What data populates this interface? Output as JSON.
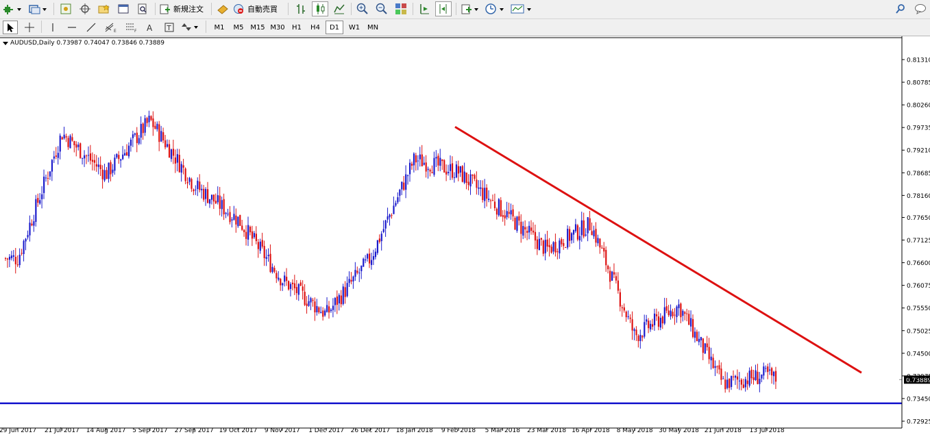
{
  "toolbar": {
    "new_order_label": "新規注文",
    "auto_trading_label": "自動売買"
  },
  "timeframes": [
    "M1",
    "M5",
    "M15",
    "M30",
    "H1",
    "H4",
    "D1",
    "W1",
    "MN"
  ],
  "active_timeframe": "D1",
  "chart": {
    "symbol": "AUDUSD,Daily",
    "ohlc": "0.73987 0.74047 0.73846 0.73889",
    "current_price": "0.73889"
  },
  "colors": {
    "bull": "#1a1acc",
    "bear": "#dd1111",
    "trendline": "#dd1111",
    "support": "#1010cc"
  },
  "chart_data": {
    "type": "candlestick",
    "symbol": "AUDUSD",
    "timeframe": "Daily",
    "y_ticks": [
      "0.81310",
      "0.80785",
      "0.80260",
      "0.79735",
      "0.79210",
      "0.78685",
      "0.78160",
      "0.77650",
      "0.77125",
      "0.76600",
      "0.76075",
      "0.75550",
      "0.75025",
      "0.74500",
      "0.73975",
      "0.73450",
      "0.72925"
    ],
    "x_ticks": [
      "29 Jun 2017",
      "21 Jul 2017",
      "14 Aug 2017",
      "5 Sep 2017",
      "27 Sep 2017",
      "19 Oct 2017",
      "9 Nov 2017",
      "1 Dec 2017",
      "26 Dec 2017",
      "18 Jan 2018",
      "9 Feb 2018",
      "5 Mar 2018",
      "23 Mar 2018",
      "16 Apr 2018",
      "8 May 2018",
      "30 May 2018",
      "21 Jun 2018",
      "13 Jul 2018"
    ],
    "ylim": [
      0.72925,
      0.8131
    ],
    "current_price": 0.73889,
    "close_path": [
      {
        "x": "29 Jun 2017",
        "y": 0.767
      },
      {
        "x": "21 Jul 2017",
        "y": 0.796
      },
      {
        "x": "14 Aug 2017",
        "y": 0.7865
      },
      {
        "x": "5 Sep 2017",
        "y": 0.799
      },
      {
        "x": "27 Sep 2017",
        "y": 0.784
      },
      {
        "x": "19 Oct 2017",
        "y": 0.776
      },
      {
        "x": "9 Nov 2017",
        "y": 0.762
      },
      {
        "x": "1 Dec 2017",
        "y": 0.754
      },
      {
        "x": "26 Dec 2017",
        "y": 0.767
      },
      {
        "x": "18 Jan 2018",
        "y": 0.79
      },
      {
        "x": "9 Feb 2018",
        "y": 0.787
      },
      {
        "x": "5 Mar 2018",
        "y": 0.778
      },
      {
        "x": "23 Mar 2018",
        "y": 0.769
      },
      {
        "x": "16 Apr 2018",
        "y": 0.775
      },
      {
        "x": "8 May 2018",
        "y": 0.749
      },
      {
        "x": "30 May 2018",
        "y": 0.756
      },
      {
        "x": "21 Jun 2018",
        "y": 0.738
      },
      {
        "x": "13 Jul 2018",
        "y": 0.74
      }
    ],
    "trendline": {
      "start": {
        "x": "9 Feb 2018",
        "y": 0.7975
      },
      "end": {
        "y": 0.7405
      }
    },
    "support_level": 0.7334
  }
}
